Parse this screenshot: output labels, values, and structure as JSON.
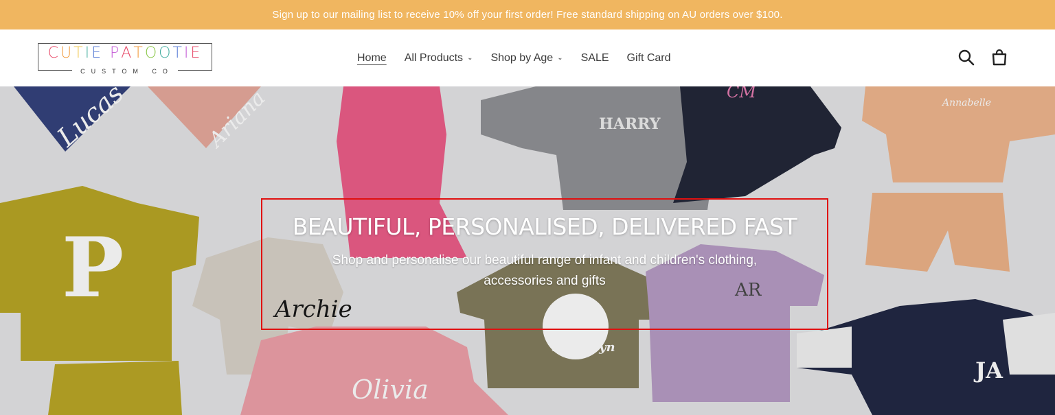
{
  "announcement": "Sign up to our mailing list to receive 10% off your first order! Free standard shipping on AU orders over $100.",
  "logo": {
    "main_letters": [
      "C",
      "U",
      "T",
      "I",
      "E",
      " ",
      "P",
      "A",
      "T",
      "O",
      "O",
      "T",
      "I",
      "E"
    ],
    "letter_colors": [
      "#e84c6b",
      "#f29a3a",
      "#f0c74a",
      "#4ab0a3",
      "#5a7ed6",
      "#ffffff",
      "#c45ad6",
      "#e84c6b",
      "#f29a3a",
      "#8cc84b",
      "#4ab0a3",
      "#5a7ed6",
      "#c45ad6",
      "#e84c6b"
    ],
    "sub": "CUSTOM CO"
  },
  "nav": {
    "items": [
      {
        "label": "Home",
        "active": true,
        "dropdown": false
      },
      {
        "label": "All Products",
        "active": false,
        "dropdown": true
      },
      {
        "label": "Shop by Age",
        "active": false,
        "dropdown": true
      },
      {
        "label": "SALE",
        "active": false,
        "dropdown": false
      },
      {
        "label": "Gift Card",
        "active": false,
        "dropdown": false
      }
    ]
  },
  "icons": {
    "search": "search-icon",
    "cart": "cart-icon"
  },
  "hero": {
    "title": "BEAUTIFUL, PERSONALISED, DELIVERED FAST",
    "subtitle": "Shop and personalise our beautiful range of infant and children's clothing, accessories and gifts",
    "garment_names": {
      "lucas": "Lucas",
      "ariana": "Ariana",
      "harry": "HARRY",
      "cm": "CM",
      "annabelle": "Annabelle",
      "p": "P",
      "archie": "Archie",
      "ar": "AR",
      "brooklyn": "Brooklyn",
      "olivia": "Olivia",
      "ja": "JA"
    }
  }
}
